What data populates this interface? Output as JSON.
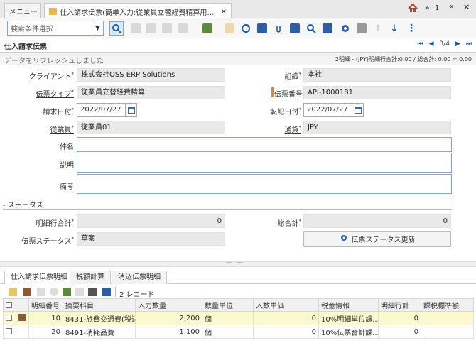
{
  "tabs": [
    {
      "label": "メニュー"
    },
    {
      "label": "仕入請求伝票(簡単入力:従業員立替経費精算用): AP...",
      "close": "×"
    }
  ],
  "topright": {
    "count": "1"
  },
  "search": {
    "placeholder": "検索条件選択"
  },
  "window": {
    "title": "仕入請求伝票",
    "record_position": "3/4"
  },
  "status": {
    "message": "データをリフレッシュしました",
    "summary": "2明細 - (JPY)明細行合計:0.00 / 総合計: 0.00 = 0.00"
  },
  "form": {
    "client": {
      "label": "クライアント",
      "value": "株式会社OSS ERP Solutions"
    },
    "org": {
      "label": "組織",
      "value": "本社"
    },
    "doctype": {
      "label": "伝票タイプ",
      "value": "従業員立替経費精算"
    },
    "docno": {
      "label": "伝票番号",
      "value": "API-1000181"
    },
    "invdate": {
      "label": "請求日付",
      "value": "2022/07/27"
    },
    "acctdate": {
      "label": "転記日付",
      "value": "2022/07/27"
    },
    "employee": {
      "label": "従業員",
      "value": "従業員01"
    },
    "currency": {
      "label": "通貨",
      "value": "JPY"
    },
    "subject": {
      "label": "件名",
      "value": ""
    },
    "description": {
      "label": "説明",
      "value": ""
    },
    "note": {
      "label": "備考",
      "value": ""
    }
  },
  "status_section": {
    "title": "- ステータス",
    "linetotal": {
      "label": "明細行合計",
      "value": "0"
    },
    "grandtotal": {
      "label": "総合計",
      "value": "0"
    },
    "docstatus": {
      "label": "伝票ステータス",
      "value": "草案"
    },
    "update_button": "伝票ステータス更新"
  },
  "detail_tabs": [
    {
      "label": "仕入請求伝票明細"
    },
    {
      "label": "税額計算"
    },
    {
      "label": "消込伝票明細"
    }
  ],
  "detail_toolbar": {
    "record_count": "2 レコード"
  },
  "grid": {
    "columns": [
      "明細番号",
      "摘要科目",
      "入力数量",
      "数量単位",
      "入数単価",
      "税金情報",
      "明細行計",
      "課税標準額"
    ],
    "rows": [
      {
        "no": "10",
        "item": "8431-旅費交通費(税込)",
        "qty": "2,200",
        "uom": "個",
        "price": "0",
        "tax": "10%明細単位課...",
        "total": "0",
        "base": ""
      },
      {
        "no": "20",
        "item": "8491-消耗品費",
        "qty": "1,100",
        "uom": "個",
        "price": "0",
        "tax": "10%伝票合計課...",
        "total": "0",
        "base": ""
      }
    ]
  },
  "colors": {
    "accent": "#1a5aa8",
    "selected_row": "#fdf9cf",
    "folder": "#e8b84a",
    "required_marker": "#e0872e"
  }
}
